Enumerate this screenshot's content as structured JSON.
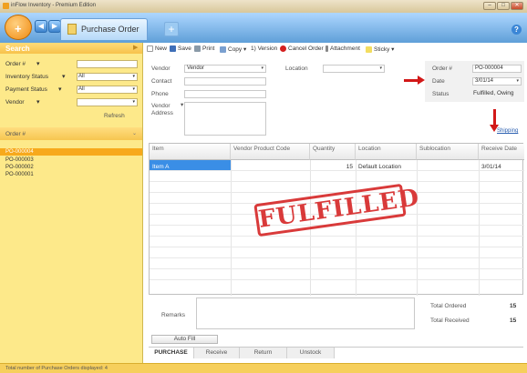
{
  "window": {
    "title": "inFlow Inventory - Premium Edition",
    "minimize": "–",
    "maximize": "□",
    "close": "✕"
  },
  "nav": {
    "orb_icon": "+",
    "back": "◀",
    "forward": "▶",
    "tab_label": "Purchase Order",
    "add_tab": "+",
    "help": "?"
  },
  "search": {
    "header": "Search",
    "fields": [
      {
        "label": "Order #",
        "value": ""
      },
      {
        "label": "Inventory Status",
        "value": "All"
      },
      {
        "label": "Payment Status",
        "value": "All"
      },
      {
        "label": "Vendor",
        "value": ""
      }
    ],
    "refresh": "Refresh"
  },
  "orders": {
    "header": "Order #",
    "items": [
      "PO-000004",
      "PO-000003",
      "PO-000002",
      "PO-000001"
    ]
  },
  "status_bar": "Total number of Purchase Orders displayed: 4",
  "toolbar": {
    "new": "New",
    "save": "Save",
    "print": "Print",
    "copy": "Copy",
    "version": "1) Version",
    "cancel_order": "Cancel Order",
    "attachment": "Attachment",
    "sticky": "Sticky"
  },
  "form": {
    "vendor_label": "Vendor",
    "vendor_value": "Vendor",
    "contact_label": "Contact",
    "phone_label": "Phone",
    "vendor_address_label": "Vendor Address",
    "location_label": "Location",
    "location_value": "",
    "order_label": "Order #",
    "order_value": "PO-000004",
    "date_label": "Date",
    "date_value": "3/01/14",
    "status_label": "Status",
    "status_value": "Fulfilled, Owing",
    "shipping_link": "Shipping"
  },
  "grid": {
    "columns": [
      "Item",
      "Vendor Product Code",
      "Quantity",
      "Location",
      "Sublocation",
      "Receive Date"
    ],
    "rows": [
      {
        "item": "Item A",
        "code": "",
        "quantity": "15",
        "location": "Default Location",
        "sublocation": "",
        "receive_date": "3/01/14"
      }
    ]
  },
  "stamp": "FULFILLED",
  "totals": {
    "remarks_label": "Remarks",
    "ordered_label": "Total Ordered",
    "ordered_value": "15",
    "received_label": "Total Received",
    "received_value": "15",
    "auto_fill": "Auto Fill"
  },
  "bottom_tabs": [
    "PURCHASE",
    "Receive",
    "Return",
    "Unstock"
  ],
  "colors": {
    "accent": "#f7a91c",
    "stamp": "#d62a2a",
    "selection": "#3a8ee6"
  }
}
